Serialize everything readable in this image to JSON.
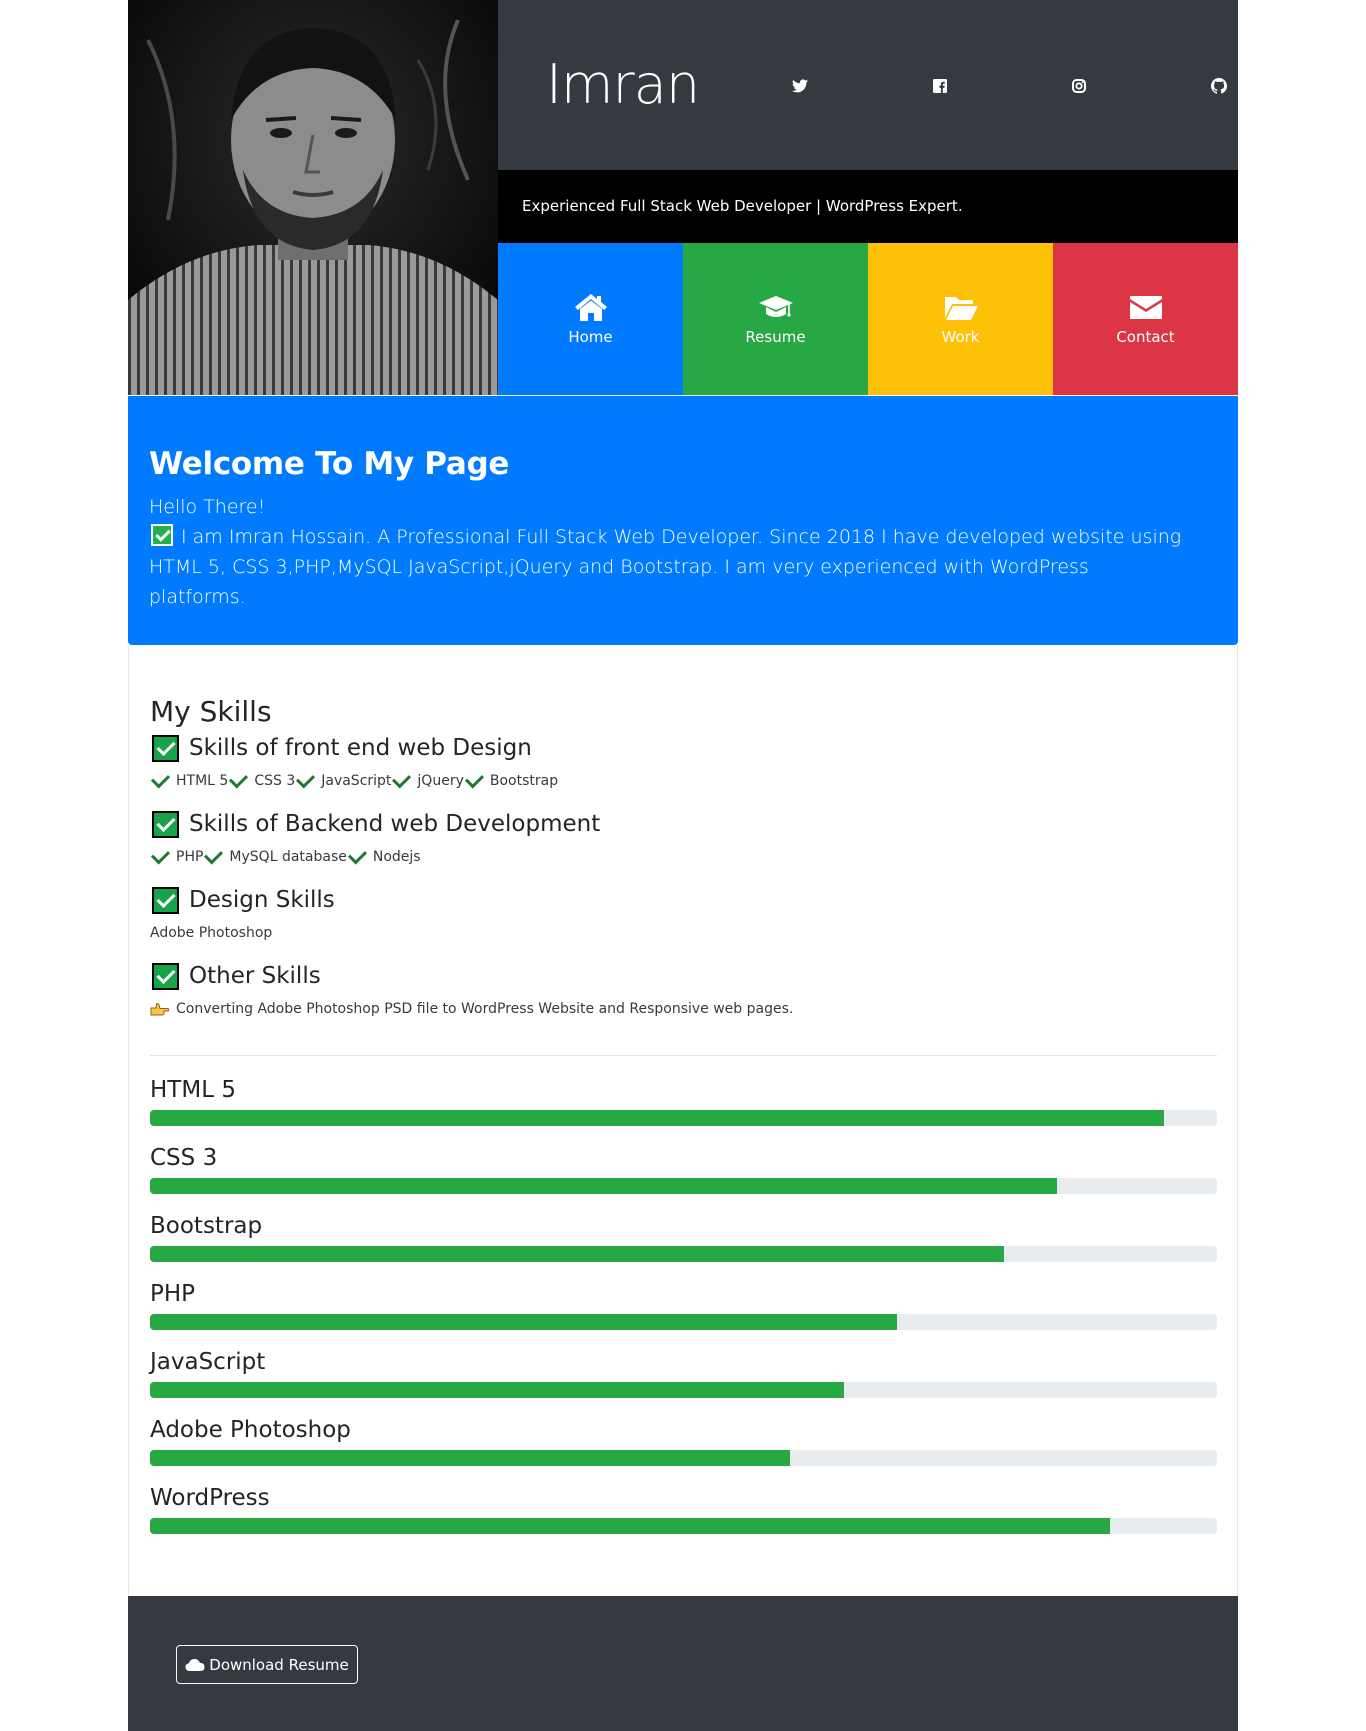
{
  "brand": {
    "name": "Imran"
  },
  "social": [
    {
      "name": "twitter"
    },
    {
      "name": "facebook"
    },
    {
      "name": "instagram"
    },
    {
      "name": "github"
    }
  ],
  "tagline": "Experienced Full Stack Web Developer | WordPress Expert.",
  "nav": {
    "home": {
      "label": "Home",
      "icon": "home-icon",
      "color": "#007bff"
    },
    "resume": {
      "label": "Resume",
      "icon": "graduation-cap-icon",
      "color": "#28a745"
    },
    "work": {
      "label": "Work",
      "icon": "folder-open-icon",
      "color": "#ffc107"
    },
    "contact": {
      "label": "Contact",
      "icon": "envelope-icon",
      "color": "#dc3545"
    }
  },
  "welcome": {
    "title": "Welcome To My Page",
    "hello": "Hello There!",
    "intro": "I am Imran Hossain. A Professional Full Stack Web Developer. Since 2018 I have developed website using HTML 5, CSS 3,PHP,MySQL JavaScript,jQuery and Bootstrap. I am very experienced with WordPress platforms."
  },
  "skills": {
    "title": "My Skills",
    "groups": [
      {
        "heading": "Skills of front end web Design",
        "items": [
          "HTML 5",
          "CSS 3",
          "JavaScript",
          "jQuery",
          "Bootstrap"
        ]
      },
      {
        "heading": "Skills of Backend web Development",
        "items": [
          "PHP",
          "MySQL database",
          "Nodejs"
        ]
      },
      {
        "heading": "Design Skills",
        "text": "Adobe Photoshop"
      },
      {
        "heading": "Other Skills",
        "text": "Converting Adobe Photoshop PSD file to WordPress Website and Responsive web pages."
      }
    ],
    "bars": [
      {
        "label": "HTML 5",
        "percent": 95
      },
      {
        "label": "CSS 3",
        "percent": 85
      },
      {
        "label": "Bootstrap",
        "percent": 80
      },
      {
        "label": "PHP",
        "percent": 70
      },
      {
        "label": "JavaScript",
        "percent": 65
      },
      {
        "label": "Adobe Photoshop",
        "percent": 60
      },
      {
        "label": "WordPress",
        "percent": 90
      }
    ],
    "bar_color": "#28a745"
  },
  "footer": {
    "download_label": "Download Resume",
    "download_icon": "cloud-icon"
  }
}
